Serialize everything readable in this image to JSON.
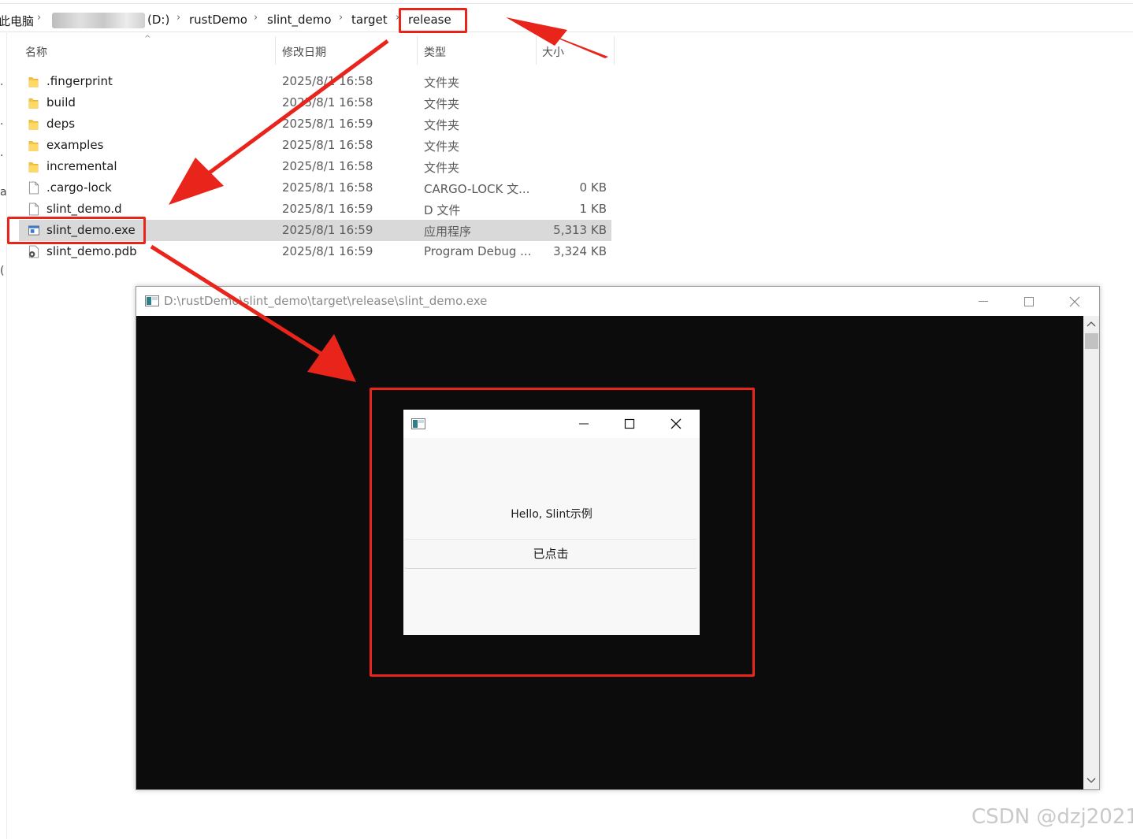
{
  "explorer": {
    "breadcrumb": {
      "root": "此电脑",
      "drive": "(D:)",
      "path": [
        "rustDemo",
        "slint_demo",
        "target",
        "release"
      ]
    },
    "columns": {
      "name": "名称",
      "date": "修改日期",
      "type": "类型",
      "size": "大小"
    },
    "files": [
      {
        "name": ".fingerprint",
        "date": "2025/8/1 16:58",
        "type": "文件夹",
        "size": "",
        "icon": "folder-icon"
      },
      {
        "name": "build",
        "date": "2025/8/1 16:58",
        "type": "文件夹",
        "size": "",
        "icon": "folder-icon"
      },
      {
        "name": "deps",
        "date": "2025/8/1 16:59",
        "type": "文件夹",
        "size": "",
        "icon": "folder-icon"
      },
      {
        "name": "examples",
        "date": "2025/8/1 16:58",
        "type": "文件夹",
        "size": "",
        "icon": "folder-icon"
      },
      {
        "name": "incremental",
        "date": "2025/8/1 16:58",
        "type": "文件夹",
        "size": "",
        "icon": "folder-icon"
      },
      {
        "name": ".cargo-lock",
        "date": "2025/8/1 16:58",
        "type": "CARGO-LOCK 文...",
        "size": "0 KB",
        "icon": "file-icon"
      },
      {
        "name": "slint_demo.d",
        "date": "2025/8/1 16:59",
        "type": "D 文件",
        "size": "1 KB",
        "icon": "file-icon"
      },
      {
        "name": "slint_demo.exe",
        "date": "2025/8/1 16:59",
        "type": "应用程序",
        "size": "5,313 KB",
        "icon": "exe-icon",
        "selected": true
      },
      {
        "name": "slint_demo.pdb",
        "date": "2025/8/1 16:59",
        "type": "Program Debug ...",
        "size": "3,324 KB",
        "icon": "pdb-icon"
      }
    ]
  },
  "console": {
    "title": "D:\\rustDemo\\slint_demo\\target\\release\\slint_demo.exe"
  },
  "slint_window": {
    "hello_text": "Hello, Slint示例",
    "button_label": "已点击"
  },
  "annotations": {
    "color": "#e8241b"
  },
  "watermark": "CSDN @dzj2021"
}
